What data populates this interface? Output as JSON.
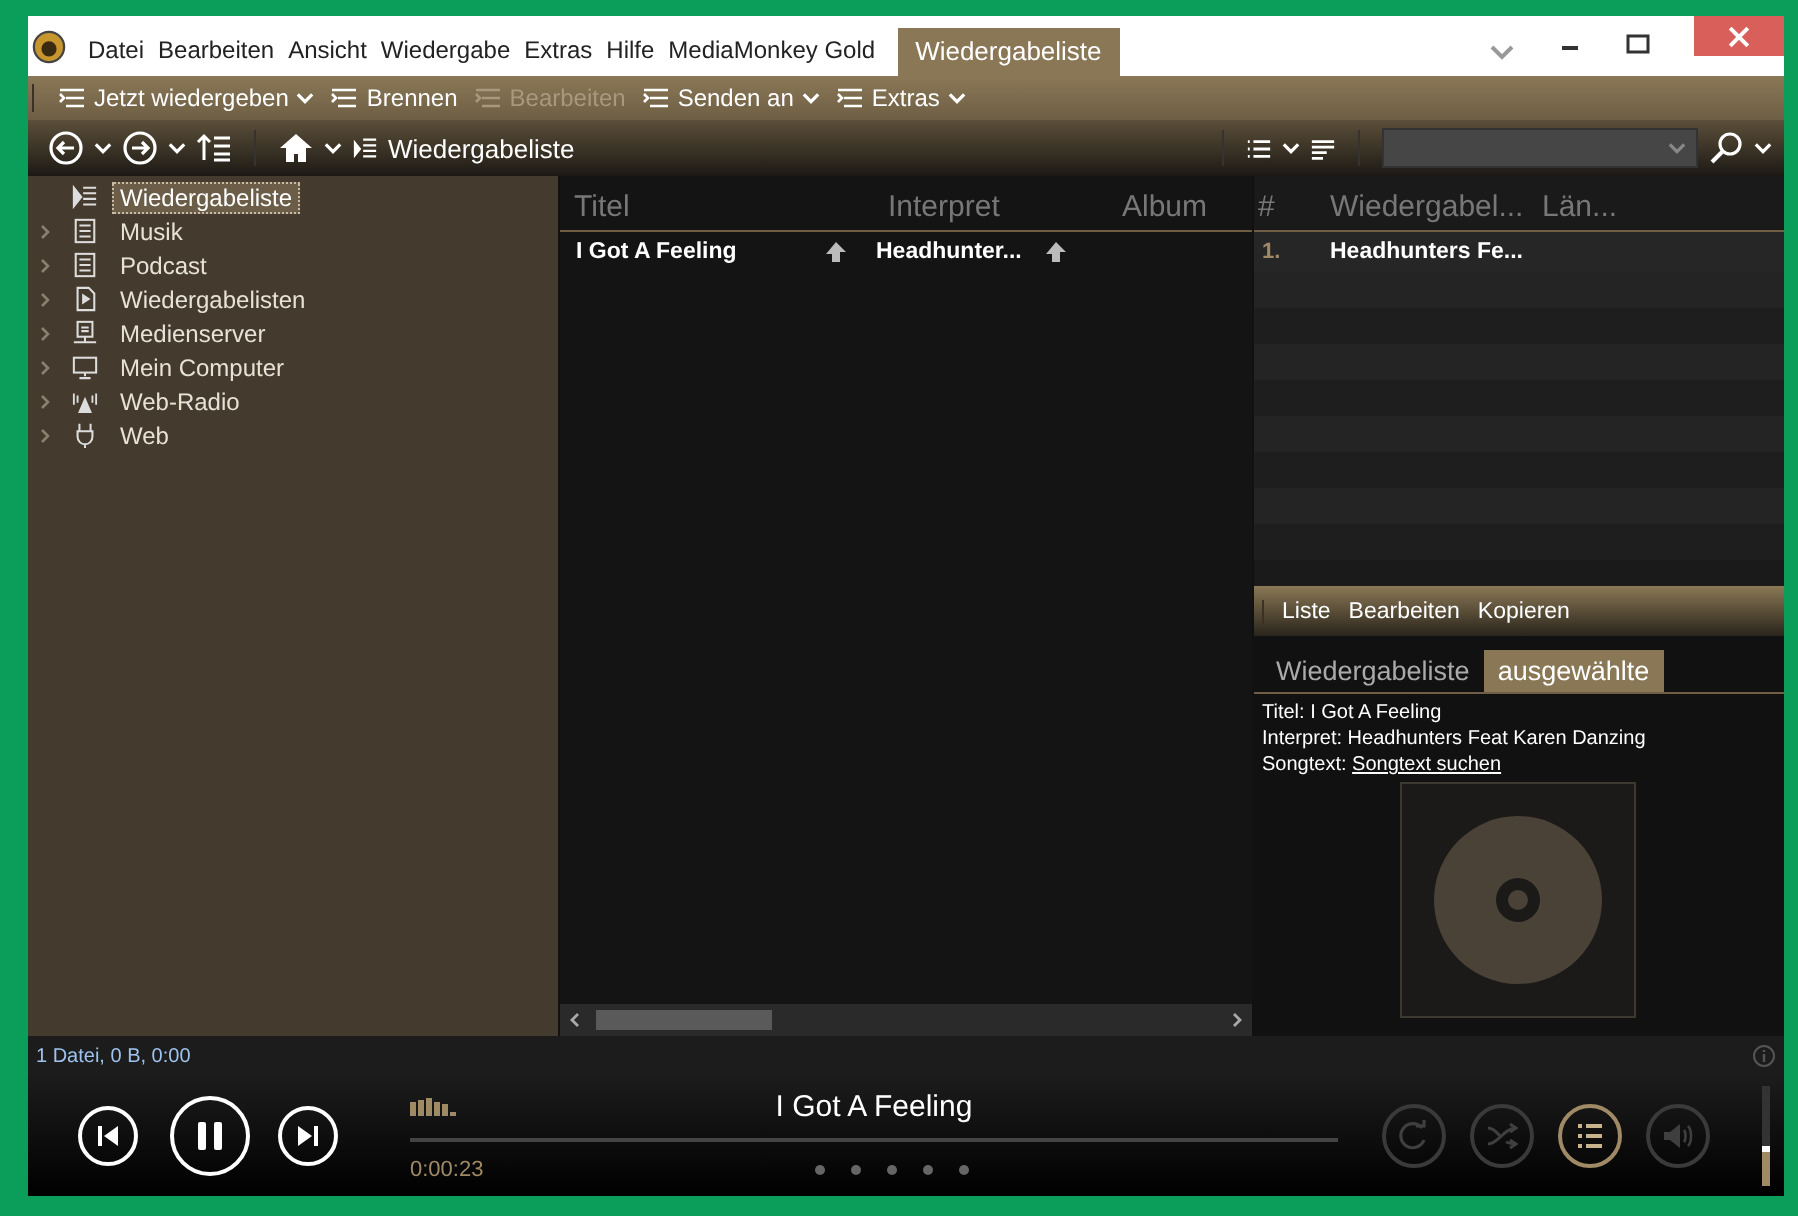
{
  "menu": [
    {
      "label": "Datei"
    },
    {
      "label": "Bearbeiten"
    },
    {
      "label": "Ansicht"
    },
    {
      "label": "Wiedergabe"
    },
    {
      "label": "Extras"
    },
    {
      "label": "Hilfe"
    },
    {
      "label": "MediaMonkey Gold"
    }
  ],
  "view_tab": {
    "label": "Wiedergabeliste"
  },
  "toolbar": [
    {
      "label": "Jetzt wiedergeben",
      "disabled": false,
      "has_menu": true
    },
    {
      "label": "Brennen",
      "disabled": false,
      "has_menu": false
    },
    {
      "label": "Bearbeiten",
      "disabled": true,
      "has_menu": false
    },
    {
      "label": "Senden an",
      "disabled": false,
      "has_menu": true
    },
    {
      "label": "Extras",
      "disabled": false,
      "has_menu": true
    }
  ],
  "breadcrumb": "Wiedergabeliste",
  "tree": [
    {
      "label": "Wiedergabeliste",
      "selected": true,
      "expandable": false
    },
    {
      "label": "Musik",
      "selected": false,
      "expandable": true
    },
    {
      "label": "Podcast",
      "selected": false,
      "expandable": true
    },
    {
      "label": "Wiedergabelisten",
      "selected": false,
      "expandable": true
    },
    {
      "label": "Medienserver",
      "selected": false,
      "expandable": true
    },
    {
      "label": "Mein Computer",
      "selected": false,
      "expandable": true
    },
    {
      "label": "Web-Radio",
      "selected": false,
      "expandable": true
    },
    {
      "label": "Web",
      "selected": false,
      "expandable": true
    }
  ],
  "tracks": {
    "columns": [
      "Titel",
      "Interpret",
      "Album"
    ],
    "rows": [
      {
        "title": "I Got A Feeling",
        "artist": "Headhunter..."
      }
    ]
  },
  "playlist": {
    "columns": [
      "#",
      "Wiedergabel...",
      "Län..."
    ],
    "rows": [
      {
        "number": "1.",
        "title": "Headhunters Fe..."
      }
    ]
  },
  "info_menu": [
    "Liste",
    "Bearbeiten",
    "Kopieren"
  ],
  "info_tabs": [
    {
      "label": "Wiedergabeliste",
      "selected": false
    },
    {
      "label": "ausgewählte",
      "selected": true
    }
  ],
  "info_fields": [
    {
      "label": "Titel:",
      "value": "I Got A Feeling"
    },
    {
      "label": "Interpret:",
      "value": "Headhunters Feat Karen Danzing"
    }
  ],
  "lyrics": {
    "label": "Songtext:",
    "link": "Songtext suchen"
  },
  "status": "1 Datei, 0 B, 0:00",
  "player": {
    "title": "I Got A Feeling",
    "time": "0:00:23",
    "playing": true,
    "toggles": [
      {
        "kind": "repeat",
        "on": false
      },
      {
        "kind": "shuffle",
        "on": false
      },
      {
        "kind": "playlist",
        "on": true
      }
    ],
    "volume": {
      "level": 0.4
    }
  }
}
